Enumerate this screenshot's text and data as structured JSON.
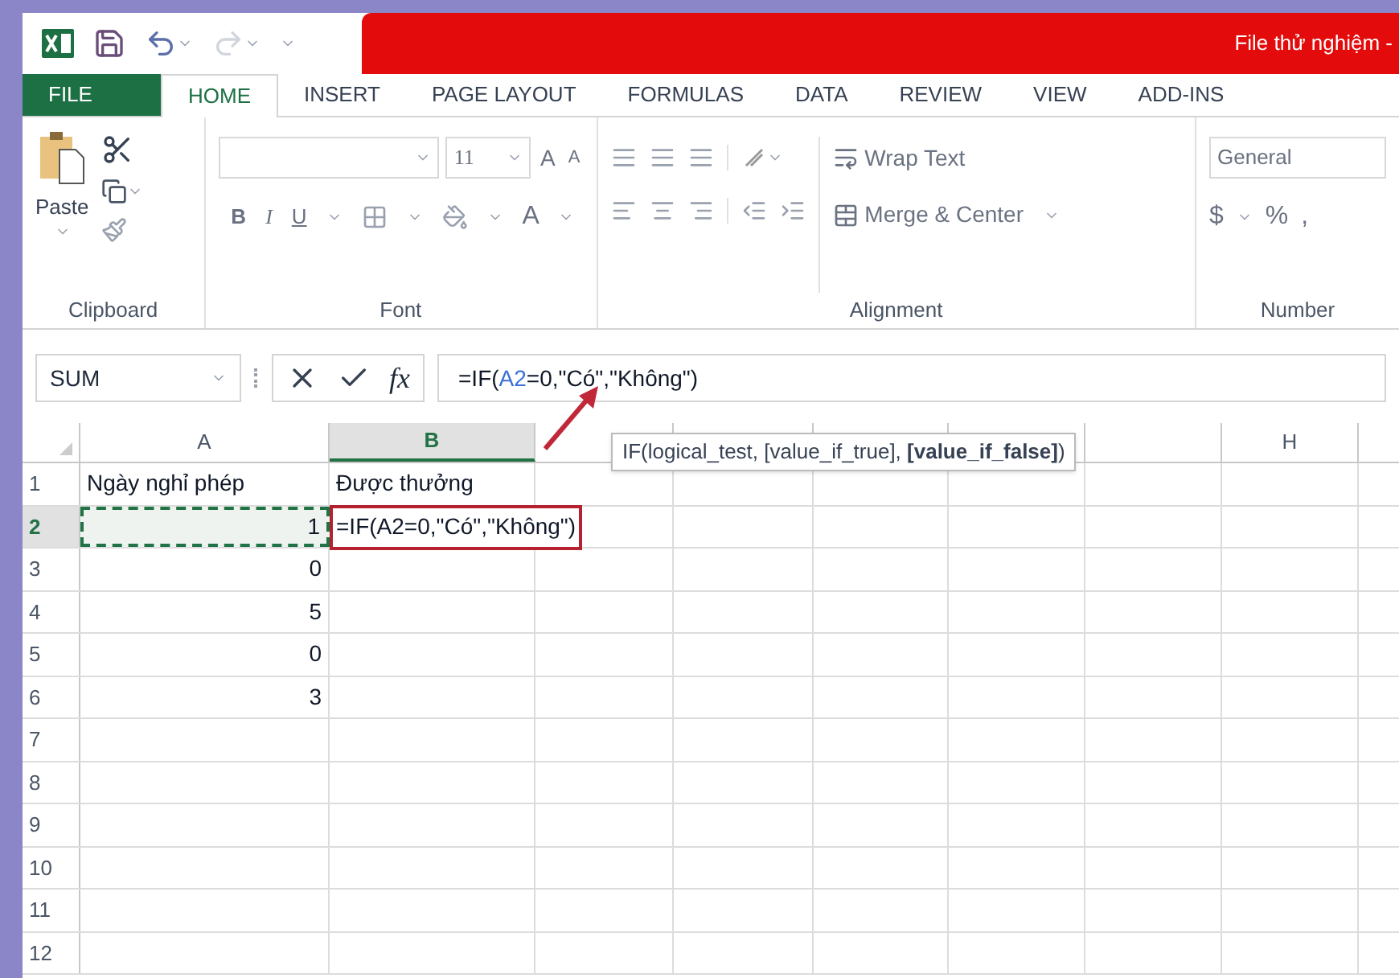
{
  "window": {
    "title": "File thử nghiệm -"
  },
  "ribbon_tabs": [
    {
      "label": "FILE",
      "kind": "file",
      "selected": false
    },
    {
      "label": "HOME",
      "kind": "tab",
      "selected": true
    },
    {
      "label": "INSERT",
      "kind": "tab",
      "selected": false
    },
    {
      "label": "PAGE LAYOUT",
      "kind": "tab",
      "selected": false
    },
    {
      "label": "FORMULAS",
      "kind": "tab",
      "selected": false
    },
    {
      "label": "DATA",
      "kind": "tab",
      "selected": false
    },
    {
      "label": "REVIEW",
      "kind": "tab",
      "selected": false
    },
    {
      "label": "VIEW",
      "kind": "tab",
      "selected": false
    },
    {
      "label": "ADD-INS",
      "kind": "tab",
      "selected": false
    }
  ],
  "ribbon": {
    "clipboard": {
      "paste": "Paste",
      "label": "Clipboard"
    },
    "font": {
      "size": "11",
      "grow": "A",
      "shrink": "A",
      "bold": "B",
      "italic": "I",
      "underline": "U",
      "font_color": "A",
      "label": "Font"
    },
    "alignment": {
      "wrap_text": "Wrap Text",
      "merge_center": "Merge & Center",
      "label": "Alignment"
    },
    "number": {
      "format": "General",
      "currency": "$",
      "percent": "%",
      "comma": ",",
      "label": "Number"
    }
  },
  "formula_bar": {
    "name_box": "SUM",
    "fx": "fx",
    "formula": [
      {
        "kind": "text",
        "text": "=IF("
      },
      {
        "kind": "ref",
        "text": "A2"
      },
      {
        "kind": "text",
        "text": "=0,\"Có\",\"Không\")"
      }
    ]
  },
  "tooltip": "IF(logical_test, [value_if_true], **[value_if_false]**)",
  "columns": [
    {
      "kind": "header",
      "label": "A",
      "selected": false
    },
    {
      "kind": "header",
      "label": "B",
      "selected": true
    },
    {
      "kind": "covered"
    },
    {
      "kind": "covered"
    },
    {
      "kind": "covered"
    },
    {
      "kind": "covered"
    },
    {
      "kind": "covered"
    },
    {
      "kind": "header",
      "label": "H",
      "selected": false
    },
    {
      "kind": "blank"
    }
  ],
  "rows": [
    {
      "number": "1",
      "selected": false,
      "cells": [
        {
          "kind": "text",
          "text": "Ngày nghỉ phép",
          "referenced": false
        },
        {
          "kind": "text",
          "text": "Được thưởng"
        }
      ]
    },
    {
      "number": "2",
      "selected": true,
      "cells": [
        {
          "kind": "number",
          "text": "1",
          "referenced": true
        },
        {
          "kind": "editing",
          "text": "=IF(A2=0,\"Có\",\"Không\")"
        }
      ]
    },
    {
      "number": "3",
      "selected": false,
      "cells": [
        {
          "kind": "number",
          "text": "0",
          "referenced": false
        }
      ]
    },
    {
      "number": "4",
      "selected": false,
      "cells": [
        {
          "kind": "number",
          "text": "5",
          "referenced": false
        }
      ]
    },
    {
      "number": "5",
      "selected": false,
      "cells": [
        {
          "kind": "number",
          "text": "0",
          "referenced": false
        }
      ]
    },
    {
      "number": "6",
      "selected": false,
      "cells": [
        {
          "kind": "number",
          "text": "3",
          "referenced": false
        }
      ]
    },
    {
      "number": "7",
      "selected": false,
      "cells": []
    },
    {
      "number": "8",
      "selected": false,
      "cells": []
    },
    {
      "number": "9",
      "selected": false,
      "cells": []
    },
    {
      "number": "10",
      "selected": false,
      "cells": []
    },
    {
      "number": "11",
      "selected": false,
      "cells": []
    },
    {
      "number": "12",
      "selected": false,
      "cells": []
    }
  ]
}
